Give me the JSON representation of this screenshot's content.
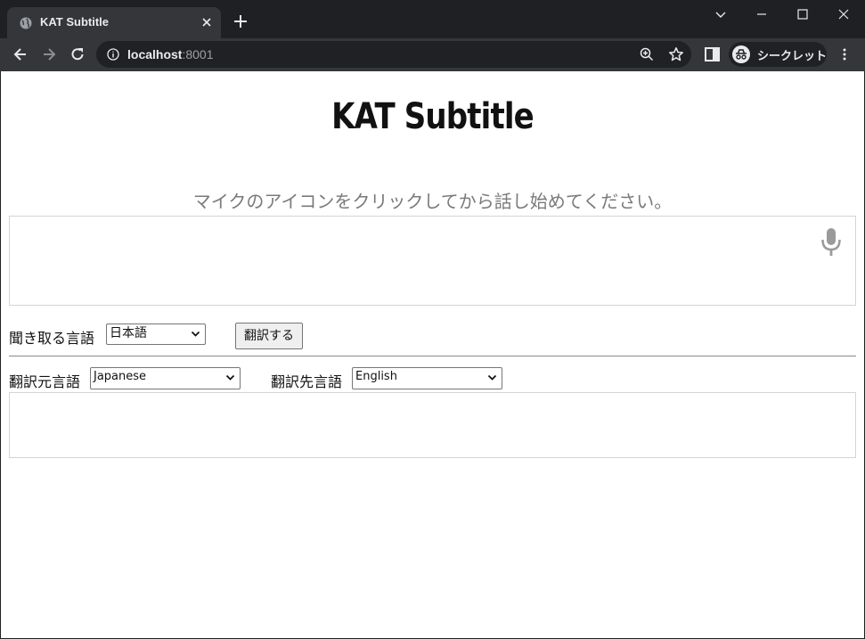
{
  "browser": {
    "tab_title": "KAT Subtitle",
    "url_host": "localhost",
    "url_port": ":8001",
    "incognito_label": "シークレット"
  },
  "page": {
    "title": "KAT Subtitle",
    "hint": "マイクのアイコンをクリックしてから話し始めてください。",
    "listen_language_label": "聞き取る言語",
    "listen_language_value": "日本語",
    "translate_button": "翻訳する",
    "source_language_label": "翻訳元言語",
    "source_language_value": "Japanese",
    "target_language_label": "翻訳先言語",
    "target_language_value": "English"
  },
  "icons": [
    "globe-icon",
    "close-icon",
    "plus-icon",
    "chevron-down-icon",
    "minimize-icon",
    "maximize-icon",
    "window-close-icon",
    "back-icon",
    "forward-icon",
    "reload-icon",
    "info-icon",
    "zoom-icon",
    "star-icon",
    "side-panel-icon",
    "incognito-icon",
    "menu-icon",
    "microphone-icon"
  ],
  "colors": {
    "chrome_dark": "#1f2023",
    "chrome_toolbar": "#35363a",
    "omnibox": "#202124",
    "hint_text": "#7a7a7a",
    "mic": "#9a9a9a"
  }
}
